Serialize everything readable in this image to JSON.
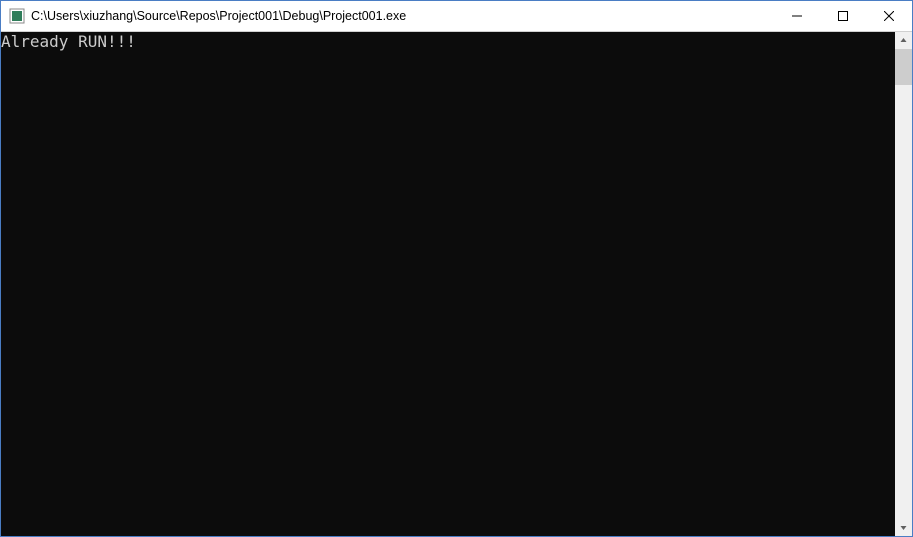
{
  "titlebar": {
    "title": "C:\\Users\\xiuzhang\\Source\\Repos\\Project001\\Debug\\Project001.exe"
  },
  "console": {
    "output": "Already RUN!!!"
  }
}
